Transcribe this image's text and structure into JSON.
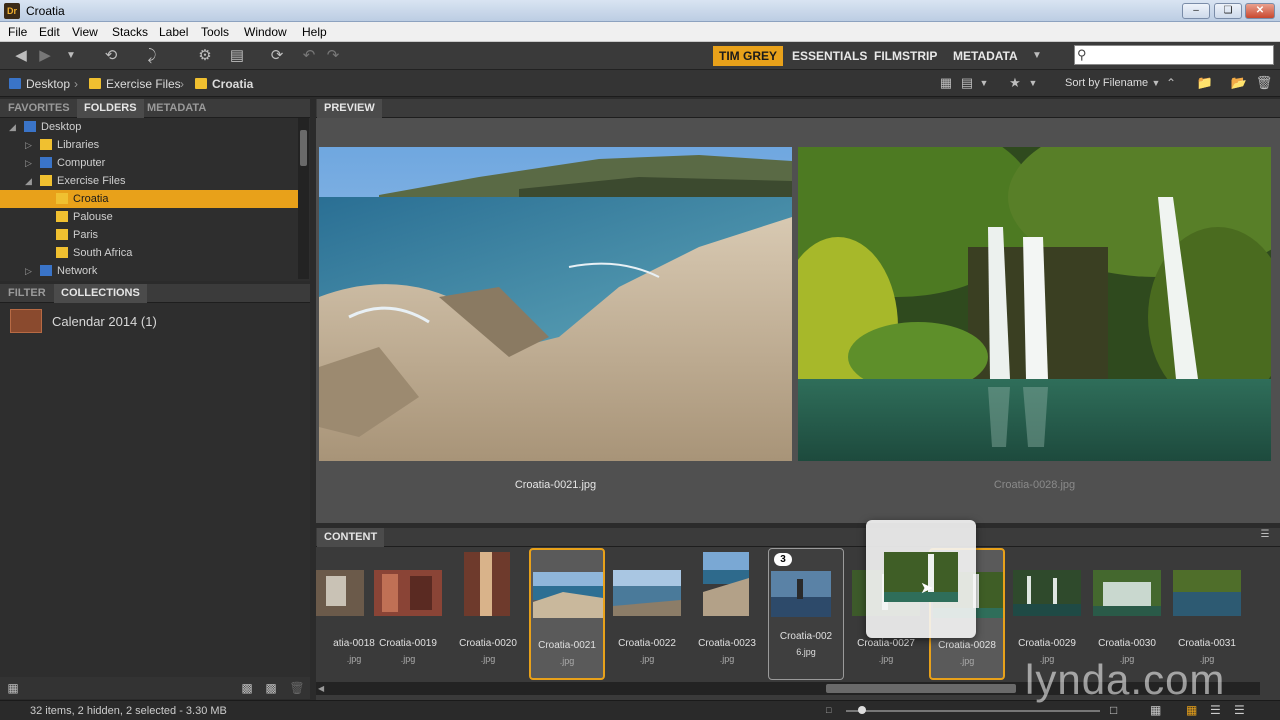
{
  "window": {
    "app_badge": "Dr",
    "title": "Croatia"
  },
  "menu": [
    "File",
    "Edit",
    "View",
    "Stacks",
    "Label",
    "Tools",
    "Window",
    "Help"
  ],
  "workspaces": [
    "TIM GREY",
    "ESSENTIALS",
    "FILMSTRIP",
    "METADATA"
  ],
  "search": {
    "placeholder": ""
  },
  "path": [
    "Desktop",
    "Exercise Files",
    "Croatia"
  ],
  "sort_label": "Sort by Filename",
  "left_tabs": [
    "FAVORITES",
    "FOLDERS",
    "METADATA"
  ],
  "tree": [
    {
      "label": "Desktop",
      "indent": 0
    },
    {
      "label": "Libraries",
      "indent": 1
    },
    {
      "label": "Computer",
      "indent": 1
    },
    {
      "label": "Exercise Files",
      "indent": 1
    },
    {
      "label": "Croatia",
      "indent": 2,
      "selected": true
    },
    {
      "label": "Palouse",
      "indent": 2
    },
    {
      "label": "Paris",
      "indent": 2
    },
    {
      "label": "South Africa",
      "indent": 2
    },
    {
      "label": "Network",
      "indent": 1
    }
  ],
  "lower_tabs": [
    "FILTER",
    "COLLECTIONS"
  ],
  "collections": [
    {
      "label": "Calendar 2014 (1)"
    }
  ],
  "preview": {
    "tab": "PREVIEW",
    "images": [
      {
        "caption": "Croatia-0021.jpg"
      },
      {
        "caption": "Croatia-0028.jpg"
      }
    ]
  },
  "content": {
    "tab": "CONTENT",
    "thumbs": [
      {
        "name": "atia-0018",
        "ext": ".jpg"
      },
      {
        "name": "Croatia-0019",
        "ext": ".jpg"
      },
      {
        "name": "Croatia-0020",
        "ext": ".jpg"
      },
      {
        "name": "Croatia-0021",
        "ext": ".jpg",
        "selected": true
      },
      {
        "name": "Croatia-0022",
        "ext": ".jpg"
      },
      {
        "name": "Croatia-0023",
        "ext": ".jpg"
      },
      {
        "name": "Croatia-002",
        "ext": "6.jpg",
        "stack": "3"
      },
      {
        "name": "Croatia-0027",
        "ext": ".jpg"
      },
      {
        "name": "Croatia-0028",
        "ext": ".jpg",
        "selected": true
      },
      {
        "name": "Croatia-0029",
        "ext": ".jpg"
      },
      {
        "name": "Croatia-0030",
        "ext": ".jpg"
      },
      {
        "name": "Croatia-0031",
        "ext": ".jpg"
      }
    ]
  },
  "status": {
    "text": "32 items, 2 hidden, 2 selected - 3.30 MB"
  },
  "watermark": "lynda.com",
  "colors": {
    "accent": "#e8a11a",
    "panel": "#2e2e2e",
    "selection": "#e8a11a"
  }
}
